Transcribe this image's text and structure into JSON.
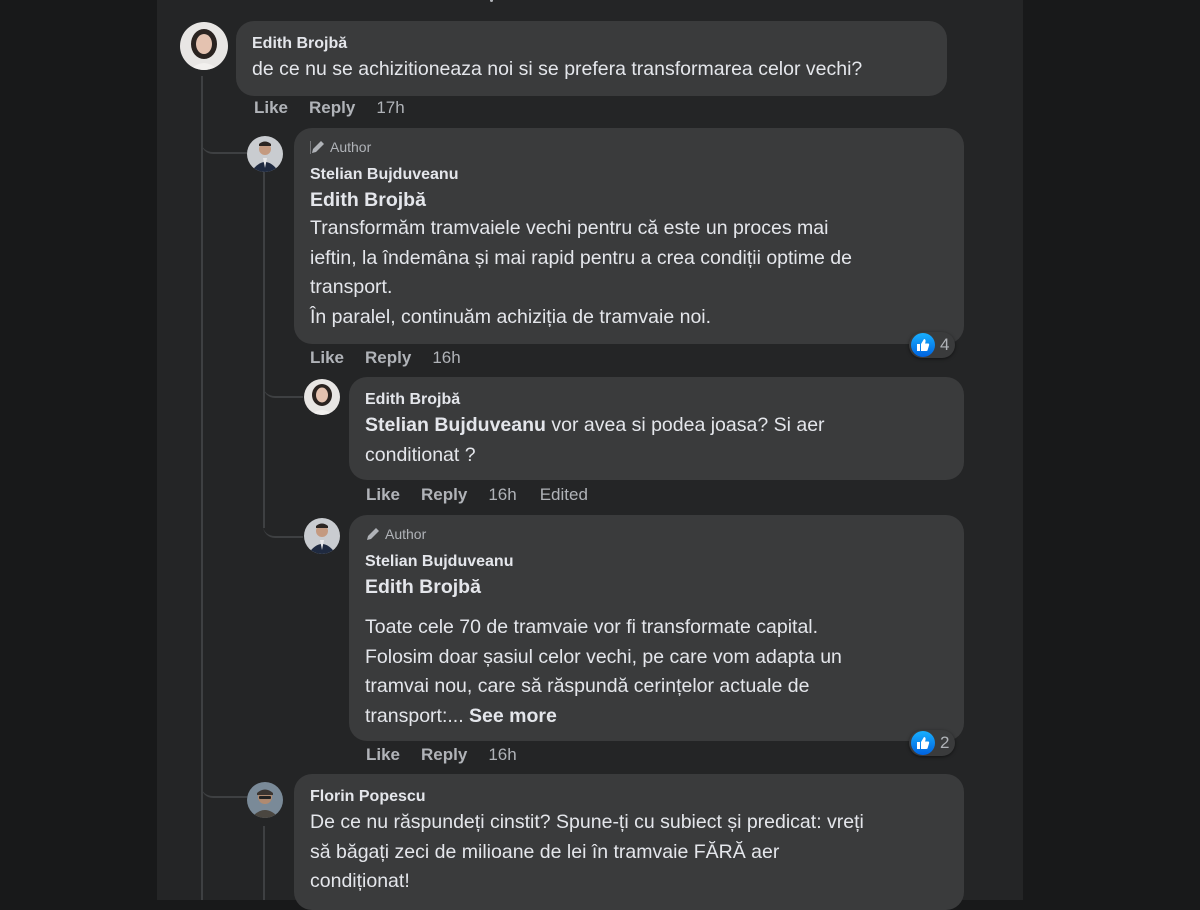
{
  "colors": {
    "page_bg": "#18191a",
    "panel_bg": "#242526",
    "bubble_bg": "#3a3b3c",
    "text": "#e4e6eb",
    "muted": "#b0b3b8",
    "like_blue": "#1877f2"
  },
  "comments": [
    {
      "name": "Edith Brojbă",
      "text": "de ce nu se achizitioneaza noi si se prefera transformarea celor vechi?",
      "actions": {
        "like": "Like",
        "reply": "Reply",
        "time": "17h"
      }
    },
    {
      "author_badge": "Author",
      "name": "Stelian Bujduveanu",
      "tag": "Edith Brojbă",
      "lines": [
        "Transformăm tramvaiele vechi pentru că este un proces mai",
        "ieftin, la îndemâna și mai rapid pentru a crea condiții optime de",
        "transport.",
        "În paralel, continuăm achiziția de tramvaie noi."
      ],
      "reactions": "4",
      "actions": {
        "like": "Like",
        "reply": "Reply",
        "time": "16h"
      }
    },
    {
      "name": "Edith Brojbă",
      "tag": "Stelian Bujduveanu",
      "line1_rest": " vor avea si podea joasa? Si aer",
      "line2": "conditionat ?",
      "actions": {
        "like": "Like",
        "reply": "Reply",
        "time": "16h",
        "edited": "Edited"
      }
    },
    {
      "author_badge": "Author",
      "name": "Stelian Bujduveanu",
      "tag": "Edith Brojbă",
      "lines": [
        "Toate cele 70 de tramvaie vor fi transformate capital.",
        "Folosim doar șasiul celor vechi, pe care vom adapta un",
        "tramvai nou, care să răspundă cerințelor actuale de"
      ],
      "last_line": "transport:... ",
      "see_more": "See more",
      "reactions": "2",
      "actions": {
        "like": "Like",
        "reply": "Reply",
        "time": "16h"
      }
    },
    {
      "name": "Florin Popescu",
      "lines": [
        "De ce nu răspundeți cinstit? Spune-ți cu subiect și predicat: vreți",
        "să băgați zeci de milioane de lei în tramvaie FĂRĂ aer",
        "condiționat!"
      ]
    }
  ]
}
